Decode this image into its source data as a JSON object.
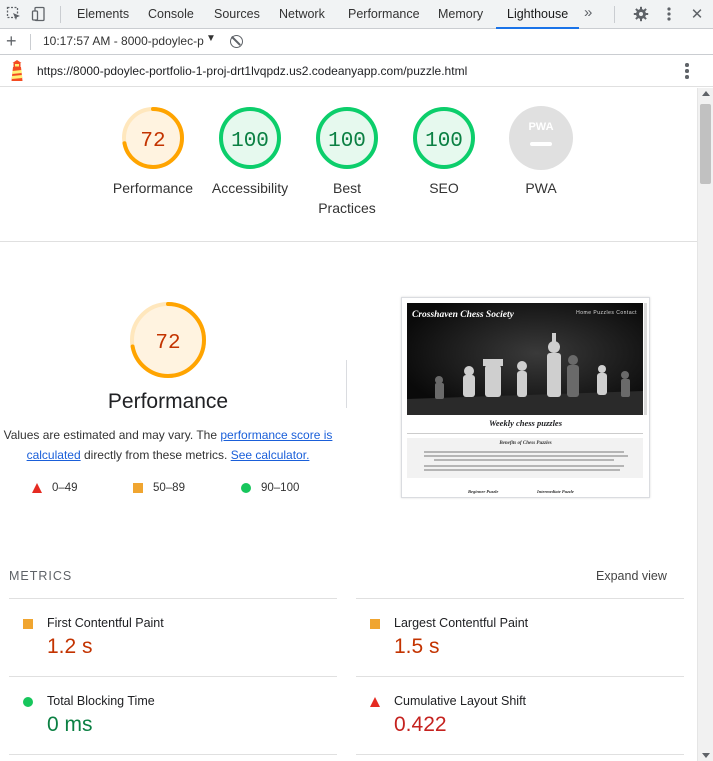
{
  "devtools": {
    "tabs": [
      "Elements",
      "Console",
      "Sources",
      "Network",
      "Performance",
      "Memory",
      "Lighthouse"
    ],
    "active_tab": "Lighthouse",
    "more_tabs_glyph": "»",
    "close_glyph": "✕"
  },
  "report_bar": {
    "add_glyph": "+",
    "selected_report": "10:17:57 AM - 8000-pdoylec-p",
    "caret": "▼"
  },
  "url": "https://8000-pdoylec-portfolio-1-proj-drt1lvqpdz.us2.codeanyapp.com/puzzle.html",
  "colors": {
    "pass": "#0cce6b",
    "average": "#ffa400",
    "fail": "#ff4e42",
    "pass_text": "#0b8043",
    "average_text": "#c33300",
    "fail_text": "#c5221f",
    "tab_accent": "#1a73e8"
  },
  "categories": [
    {
      "label": "Performance",
      "score": 72,
      "rating": "average"
    },
    {
      "label": "Accessibility",
      "score": 100,
      "rating": "pass"
    },
    {
      "label": "Best Practices",
      "score": 100,
      "rating": "pass"
    },
    {
      "label": "SEO",
      "score": 100,
      "rating": "pass"
    },
    {
      "label": "PWA",
      "score": null,
      "rating": "na",
      "badge": "PWA"
    }
  ],
  "performance": {
    "score": 72,
    "title": "Performance",
    "note_pre": "Values are estimated and may vary. The ",
    "note_link1": "performance score is calculated",
    "note_mid": " directly from these metrics. ",
    "note_link2": "See calculator.",
    "legend": [
      {
        "shape": "triangle",
        "range": "0–49"
      },
      {
        "shape": "square",
        "range": "50–89"
      },
      {
        "shape": "circle",
        "range": "90–100"
      }
    ]
  },
  "screenshot": {
    "site_title": "Crosshaven Chess Society",
    "nav": "Home   Puzzles   Contact",
    "heading": "Weekly chess puzzles",
    "subheading": "Benefits of Chess Puzzles",
    "footer_left": "Beginner Puzzle",
    "footer_right": "Intermediate Puzzle"
  },
  "metrics": {
    "heading": "METRICS",
    "expand_label": "Expand view",
    "items": [
      {
        "name": "First Contentful Paint",
        "value": "1.2 s",
        "rating": "average"
      },
      {
        "name": "Largest Contentful Paint",
        "value": "1.5 s",
        "rating": "average"
      },
      {
        "name": "Total Blocking Time",
        "value": "0 ms",
        "rating": "pass"
      },
      {
        "name": "Cumulative Layout Shift",
        "value": "0.422",
        "rating": "fail"
      }
    ]
  }
}
